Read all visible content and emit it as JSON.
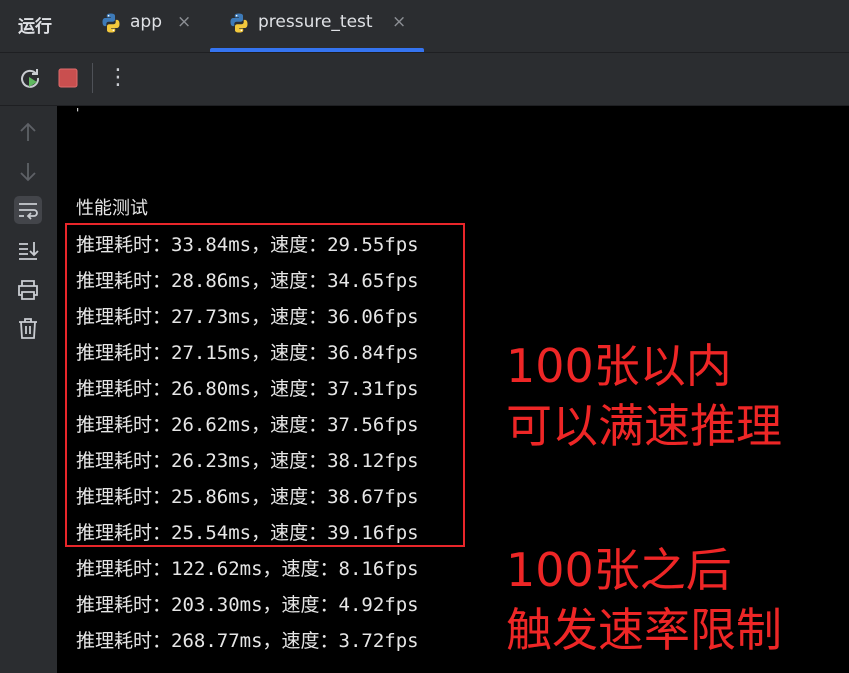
{
  "tabbar": {
    "run_title": "运行",
    "tabs": [
      {
        "label": "app",
        "icon": "python-icon",
        "active": false
      },
      {
        "label": "pressure_test",
        "icon": "python-icon",
        "active": true
      }
    ],
    "close_glyph": "×"
  },
  "toolbar": {
    "buttons": [
      "rerun-icon",
      "stop-icon",
      "more-options-icon"
    ],
    "more_glyph": "⋮"
  },
  "gutter": {
    "buttons": [
      "up-arrow-icon",
      "down-arrow-icon",
      "soft-wrap-icon",
      "scroll-to-end-icon",
      "print-icon",
      "trash-icon"
    ]
  },
  "console": {
    "stray_mark": "'",
    "header": "性能测试",
    "lines": [
      "推理耗时：33.84ms，速度：29.55fps",
      "推理耗时：28.86ms，速度：34.65fps",
      "推理耗时：27.73ms，速度：36.06fps",
      "推理耗时：27.15ms，速度：36.84fps",
      "推理耗时：26.80ms，速度：37.31fps",
      "推理耗时：26.62ms，速度：37.56fps",
      "推理耗时：26.23ms，速度：38.12fps",
      "推理耗时：25.86ms，速度：38.67fps",
      "推理耗时：25.54ms，速度：39.16fps",
      "推理耗时：122.62ms，速度：8.16fps",
      "推理耗时：203.30ms，速度：4.92fps",
      "推理耗时：268.77ms，速度：3.72fps"
    ]
  },
  "annotations": {
    "top": [
      "100张以内",
      "可以满速推理"
    ],
    "bottom": [
      "100张之后",
      "触发速率限制"
    ],
    "color": "#ee2626"
  },
  "colors": {
    "accent": "#3574f0",
    "highlight_box": "#e8262a",
    "stop": "#c94f4f",
    "rerun": "#5fb85f"
  }
}
